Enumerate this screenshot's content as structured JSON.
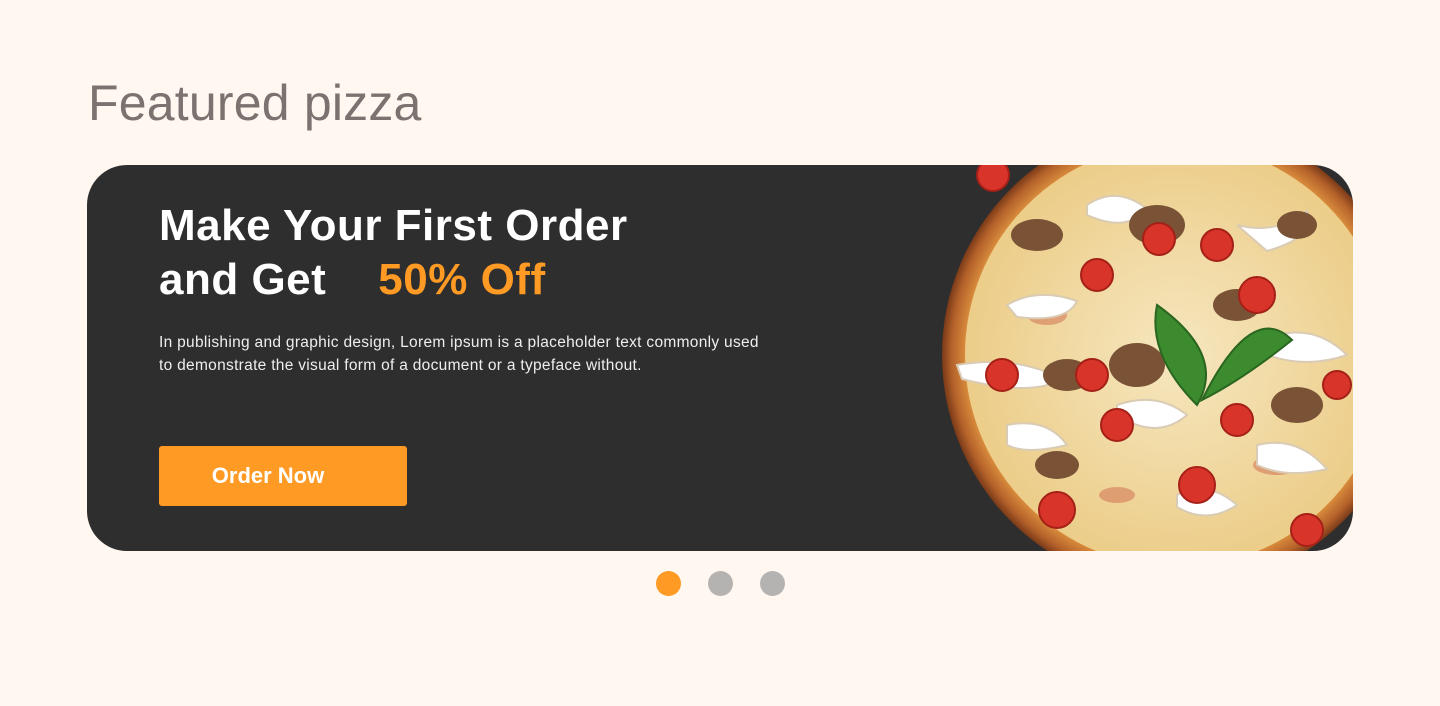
{
  "section": {
    "title": "Featured pizza"
  },
  "banner": {
    "headline_line1": "Make Your First Order",
    "headline_line2": "and Get",
    "headline_accent": "50% Off",
    "description": "In publishing and graphic design, Lorem ipsum is a placeholder text commonly used to demonstrate the visual form of a document or a typeface without.",
    "cta_label": "Order Now",
    "image": "pizza-image"
  },
  "carousel": {
    "slide_count": 3,
    "active_index": 0
  },
  "colors": {
    "background": "#fff7f0",
    "banner": "#2e2e2e",
    "accent": "#ff9a24",
    "dot_inactive": "#b5b3b1"
  }
}
